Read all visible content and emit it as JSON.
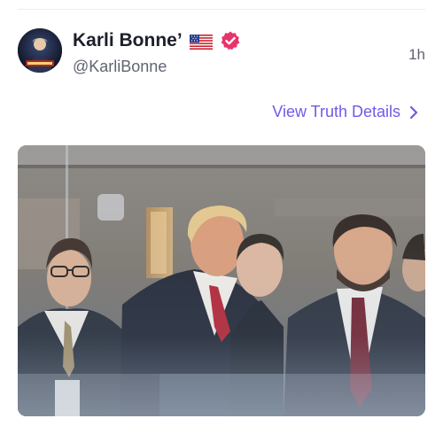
{
  "post": {
    "author_name": "Karli Bonne’",
    "handle": "@KarliBonne",
    "timestamp": "1h",
    "details_link": "View Truth Details"
  },
  "icons": {
    "flag": "us-flag-icon",
    "verified": "verified-badge-icon",
    "chevron": "chevron-right-icon"
  },
  "colors": {
    "link": "#6e5ce6",
    "verified": "#e8336b",
    "name": "#1b1f29",
    "muted": "#5f6470"
  }
}
